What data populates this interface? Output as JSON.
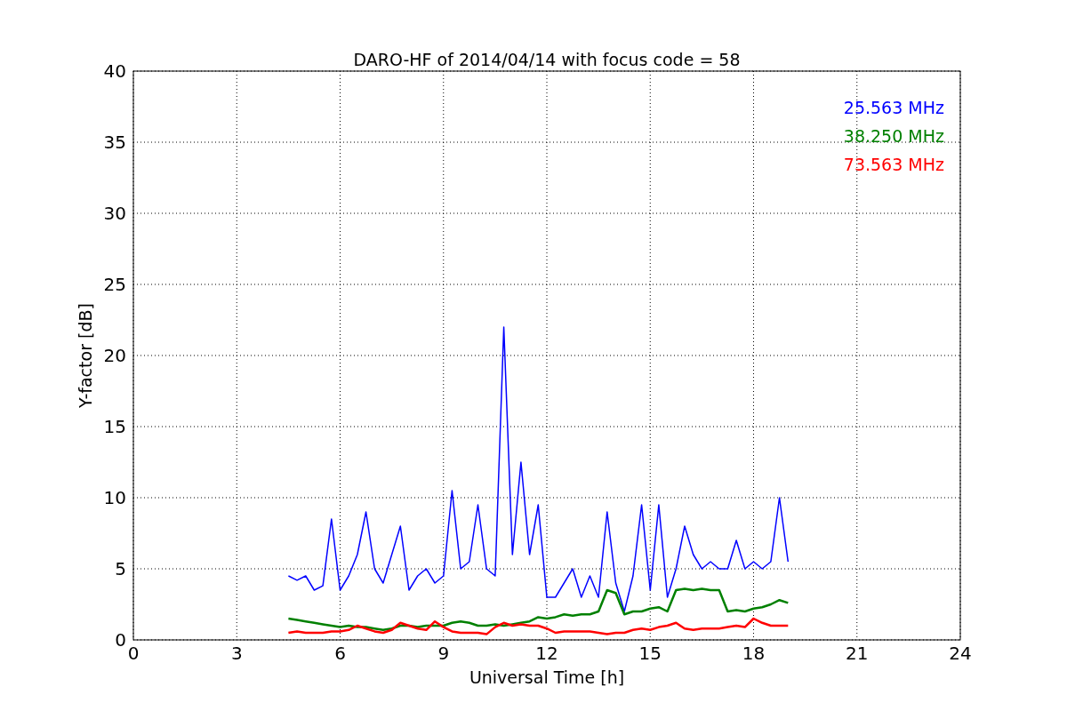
{
  "chart_data": {
    "type": "line",
    "title": "DARO-HF of 2014/04/14 with focus code = 58",
    "xlabel": "Universal Time [h]",
    "ylabel": "Y-factor [dB]",
    "x": [
      4.5,
      4.75,
      5,
      5.25,
      5.5,
      5.75,
      6,
      6.25,
      6.5,
      6.75,
      7,
      7.25,
      7.5,
      7.75,
      8,
      8.25,
      8.5,
      8.75,
      9,
      9.25,
      9.5,
      9.75,
      10,
      10.25,
      10.5,
      10.75,
      11,
      11.25,
      11.5,
      11.75,
      12,
      12.25,
      12.5,
      12.75,
      13,
      13.25,
      13.5,
      13.75,
      14,
      14.25,
      14.5,
      14.75,
      15,
      15.25,
      15.5,
      15.75,
      16,
      16.25,
      16.5,
      16.75,
      17,
      17.25,
      17.5,
      17.75,
      18,
      18.25,
      18.5,
      18.75,
      19
    ],
    "series": [
      {
        "name": "25.563 MHz",
        "color": "#0000ff",
        "values": [
          4.5,
          4.2,
          4.5,
          3.5,
          3.8,
          8.5,
          3.5,
          4.5,
          6,
          9,
          5,
          4,
          6,
          8,
          3.5,
          4.5,
          5,
          4,
          4.5,
          10.5,
          5,
          5.5,
          9.5,
          5,
          4.5,
          22,
          6,
          12.5,
          6,
          9.5,
          3,
          3,
          4,
          5,
          3,
          4.5,
          3,
          9,
          4,
          2,
          4.5,
          9.5,
          3.5,
          9.5,
          3,
          5,
          8,
          6,
          5,
          5.5,
          5,
          5,
          7,
          5,
          5.5,
          5,
          5.5,
          10,
          5.5
        ]
      },
      {
        "name": "38.250 MHz",
        "color": "#008000",
        "values": [
          1.5,
          1.4,
          1.3,
          1.2,
          1.1,
          1.0,
          0.9,
          1.0,
          0.9,
          0.9,
          0.8,
          0.7,
          0.8,
          1.0,
          1.0,
          0.9,
          1.0,
          1.0,
          1.0,
          1.2,
          1.3,
          1.2,
          1.0,
          1.0,
          1.1,
          1.0,
          1.1,
          1.2,
          1.3,
          1.6,
          1.5,
          1.6,
          1.8,
          1.7,
          1.8,
          1.8,
          2.0,
          3.5,
          3.3,
          1.8,
          2.0,
          2.0,
          2.2,
          2.3,
          2.0,
          3.5,
          3.6,
          3.5,
          3.6,
          3.5,
          3.5,
          2.0,
          2.1,
          2.0,
          2.2,
          2.3,
          2.5,
          2.8,
          2.6
        ]
      },
      {
        "name": "73.563 MHz",
        "color": "#ff0000",
        "values": [
          0.5,
          0.6,
          0.5,
          0.5,
          0.5,
          0.6,
          0.6,
          0.7,
          1.0,
          0.8,
          0.6,
          0.5,
          0.7,
          1.2,
          1.0,
          0.8,
          0.7,
          1.3,
          0.9,
          0.6,
          0.5,
          0.5,
          0.5,
          0.4,
          0.9,
          1.2,
          1.0,
          1.1,
          1.0,
          1.0,
          0.8,
          0.5,
          0.6,
          0.6,
          0.6,
          0.6,
          0.5,
          0.4,
          0.5,
          0.5,
          0.7,
          0.8,
          0.7,
          0.9,
          1.0,
          1.2,
          0.8,
          0.7,
          0.8,
          0.8,
          0.8,
          0.9,
          1.0,
          0.9,
          1.5,
          1.2,
          1.0,
          1.0,
          1.0
        ]
      }
    ],
    "grid": true,
    "xlim": [
      0,
      24
    ],
    "ylim": [
      0,
      40
    ],
    "xticks": [
      0,
      3,
      6,
      9,
      12,
      15,
      18,
      21,
      24
    ],
    "yticks": [
      0,
      5,
      10,
      15,
      20,
      25,
      30,
      35,
      40
    ]
  }
}
